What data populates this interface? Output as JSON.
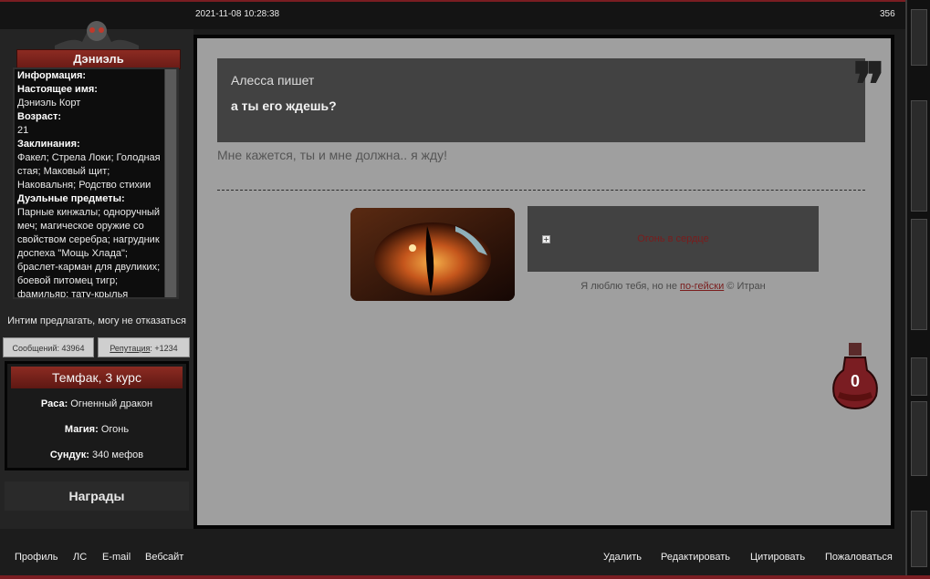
{
  "post": {
    "date": "2021-11-08 10:28:38",
    "number": "356"
  },
  "profile": {
    "name": "Дэниэль",
    "info_lines": [
      {
        "label": "Информация:",
        "value": ""
      },
      {
        "label": "Настоящее имя:",
        "value": "Дэниэль Корт"
      },
      {
        "label": "Возраст:",
        "value": "21"
      },
      {
        "label": "Заклинания:",
        "value": "Факел; Стрела Локи; Голодная стая; Маковый щит; Наковальня; Родство стихии"
      },
      {
        "label": "Дуэльные предметы:",
        "value": "Парные кинжалы; одноручный меч; магическое оружие со свойством серебра; нагрудник доспеха \"Мощь Хлада\"; браслет-карман для двуликих; боевой питомец тигр; фамильяр; тату-крылья"
      }
    ],
    "tagline": "Интим предлагать, могу не отказаться",
    "messages_label": "Сообщений: 43964",
    "reputation_link": "Репутация",
    "reputation_value": ": +1234",
    "faculty": "Темфак, 3 курс",
    "race_label": "Раса:",
    "race_value": " Огненный дракон",
    "magic_label": "Магия:",
    "magic_value": " Огонь",
    "chest_label": "Сундук:",
    "chest_value": " 340 мефов",
    "awards_label": "Награды"
  },
  "content": {
    "quote_author": "Алесса пишет",
    "quote_text": "а ты его ждешь?",
    "quote_mark": "❞",
    "reply_text": "Мне кажется, ты и мне должна.. я жду!",
    "spoiler_icon": "+",
    "spoiler_title": "Огонь в сердце",
    "signature_prefix": "Я люблю тебя, но не ",
    "signature_link": "по-гейски",
    "signature_suffix": " © Итран",
    "potion_count": "0",
    "image_icon": "dragon-eye-image",
    "potion_icon": "potion-bottle-icon"
  },
  "footer": {
    "left": [
      "Профиль",
      "ЛС",
      "E-mail",
      "Вебсайт"
    ],
    "right": [
      "Удалить",
      "Редактировать",
      "Цитировать",
      "Пожаловаться"
    ]
  },
  "colors": {
    "accent_red": "#7a1d22",
    "post_bg": "#9f9f9f",
    "quote_bg": "#424242"
  }
}
